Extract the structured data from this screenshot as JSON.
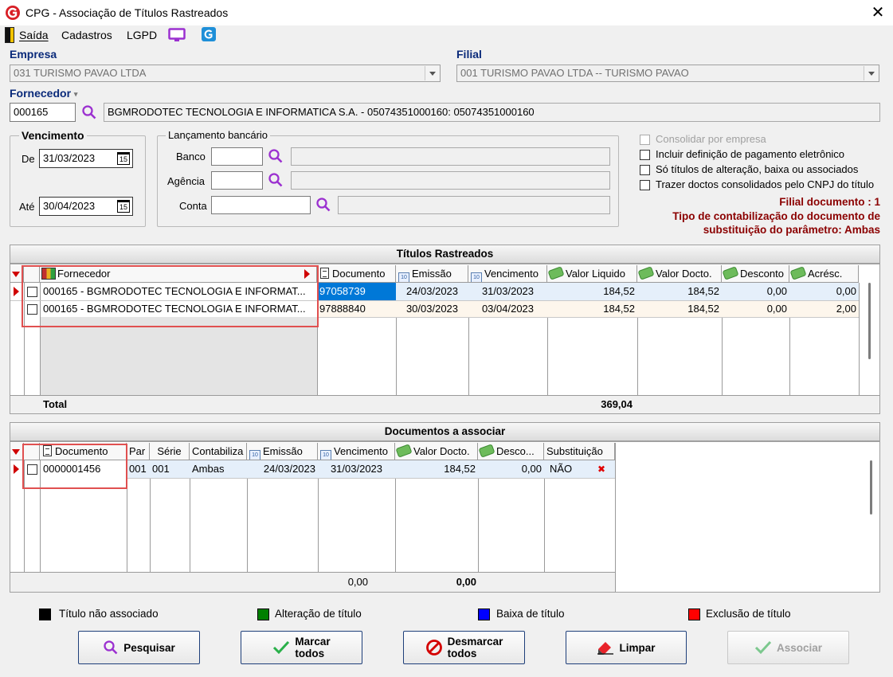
{
  "window": {
    "title": "CPG - Associação de Títulos Rastreados",
    "close": "✕"
  },
  "menu": {
    "saida": "Saída",
    "cadastros": "Cadastros",
    "lgpd": "LGPD"
  },
  "empresa": {
    "label": "Empresa",
    "value": "031 TURISMO PAVAO LTDA"
  },
  "filial": {
    "label": "Filial",
    "value": "001 TURISMO PAVAO LTDA -- TURISMO PAVAO"
  },
  "fornecedor": {
    "label": "Fornecedor",
    "code": "000165",
    "name": "BGMRODOTEC TECNOLOGIA E INFORMATICA S.A. - 05074351000160: 05074351000160"
  },
  "vencimento": {
    "title": "Vencimento",
    "de_label": "De",
    "de_value": "31/03/2023",
    "ate_label": "Até",
    "ate_value": "30/04/2023",
    "cal_glyph": "15"
  },
  "lancamento": {
    "title": "Lançamento bancário",
    "banco_label": "Banco",
    "agencia_label": "Agência",
    "conta_label": "Conta"
  },
  "options": {
    "consolidar": "Consolidar por empresa",
    "incluir": "Incluir definição de pagamento eletrônico",
    "so_titulos": "Só títulos de alteração, baixa ou associados",
    "trazer": "Trazer doctos consolidados pelo CNPJ do título"
  },
  "info": {
    "filial_doc": "Filial documento : 1",
    "tipo_line1": "Tipo de contabilização do documento de",
    "tipo_line2": "substituição do parâmetro: Ambas"
  },
  "titulos": {
    "header": "Títulos Rastreados",
    "columns": [
      "Fornecedor",
      "Documento",
      "Emissão",
      "Vencimento",
      "Valor Liquido",
      "Valor Docto.",
      "Desconto",
      "Acrésc."
    ],
    "rows": [
      {
        "fornecedor": "000165 - BGMRODOTEC TECNOLOGIA E INFORMAT...",
        "documento": "97058739",
        "emissao": "24/03/2023",
        "vencimento": "31/03/2023",
        "valor_liquido": "184,52",
        "valor_docto": "184,52",
        "desconto": "0,00",
        "acresc": "0,00"
      },
      {
        "fornecedor": "000165 - BGMRODOTEC TECNOLOGIA E INFORMAT...",
        "documento": "97888840",
        "emissao": "30/03/2023",
        "vencimento": "03/04/2023",
        "valor_liquido": "184,52",
        "valor_docto": "184,52",
        "desconto": "0,00",
        "acresc": "2,00"
      }
    ],
    "total_label": "Total",
    "total_value": "369,04"
  },
  "documentos": {
    "header": "Documentos a associar",
    "columns": [
      "Documento",
      "Par",
      "Série",
      "Contabiliza",
      "Emissão",
      "Vencimento",
      "Valor Docto.",
      "Desco...",
      "Substituição"
    ],
    "rows": [
      {
        "documento": "0000001456",
        "par": "001",
        "serie": "001",
        "contabiliza": "Ambas",
        "emissao": "24/03/2023",
        "vencimento": "31/03/2023",
        "valor_docto": "184,52",
        "desconto": "0,00",
        "substituicao": "NÃO",
        "delete": "✖"
      }
    ],
    "footer_emissao": "0,00",
    "footer_valor": "0,00"
  },
  "legend": {
    "nao_associado": "Título não associado",
    "alteracao": "Alteração de título",
    "baixa": "Baixa de título",
    "exclusao": "Exclusão de título",
    "colors": {
      "nao_associado": "#000000",
      "alteracao": "#008000",
      "baixa": "#0000ff",
      "exclusao": "#ff0000"
    }
  },
  "buttons": {
    "pesquisar": "Pesquisar",
    "marcar_1": "Marcar",
    "marcar_2": "todos",
    "desmarcar_1": "Desmarcar",
    "desmarcar_2": "todos",
    "limpar": "Limpar",
    "associar": "Associar"
  },
  "colors": {
    "accent_blue": "#0a2a7a",
    "selection": "#0078d7",
    "row_alt": "#fdf6ec",
    "icon_purple": "#9b30d0"
  }
}
